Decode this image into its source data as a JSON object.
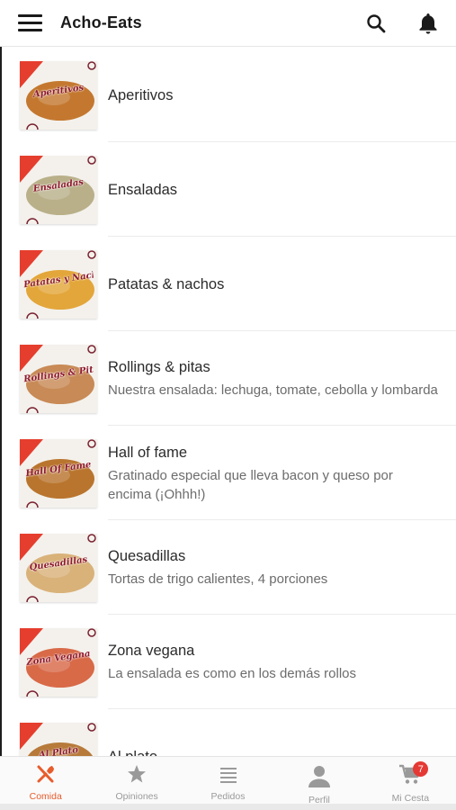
{
  "app": {
    "title": "Acho-Eats"
  },
  "icons": {
    "menu": "menu-icon",
    "search": "search-icon",
    "notifications": "bell-icon"
  },
  "categories": [
    {
      "title": "Aperitivos",
      "desc": "",
      "thumb_label": "Aperitivos",
      "photo": "#c4782f"
    },
    {
      "title": "Ensaladas",
      "desc": "",
      "thumb_label": "Ensaladas",
      "photo": "#b9b08a"
    },
    {
      "title": "Patatas & nachos",
      "desc": "",
      "thumb_label": "Patatas y Nachos",
      "photo": "#e3a63a"
    },
    {
      "title": "Rollings & pitas",
      "desc": "Nuestra ensalada: lechuga, tomate, cebolla y lombarda",
      "thumb_label": "Rollings & Pitas",
      "photo": "#c88a56"
    },
    {
      "title": "Hall of fame",
      "desc": "Gratinado especial que lleva bacon y queso por encima (¡Ohhh!)",
      "thumb_label": "Hall Of Fame",
      "photo": "#b9752e"
    },
    {
      "title": "Quesadillas",
      "desc": "Tortas de trigo calientes, 4 porciones",
      "thumb_label": "Quesadillas",
      "photo": "#d9b27a"
    },
    {
      "title": "Zona vegana",
      "desc": "La ensalada es como en los demás rollos",
      "thumb_label": "Zona Vegana",
      "photo": "#d86a48"
    },
    {
      "title": "Al plato",
      "desc": "",
      "thumb_label": "Al Plato",
      "photo": "#b77a3a"
    }
  ],
  "nav": [
    {
      "label": "Comida",
      "icon": "fork-knife-icon",
      "active": true
    },
    {
      "label": "Opiniones",
      "icon": "star-icon",
      "active": false
    },
    {
      "label": "Pedidos",
      "icon": "list-icon",
      "active": false
    },
    {
      "label": "Perfil",
      "icon": "person-icon",
      "active": false
    },
    {
      "label": "Mi Cesta",
      "icon": "cart-icon",
      "active": false,
      "badge": "7"
    }
  ],
  "colors": {
    "accent": "#e85c2c",
    "brand_red": "#e53e2e",
    "badge": "#e53935",
    "inactive": "#9a9a9a"
  }
}
